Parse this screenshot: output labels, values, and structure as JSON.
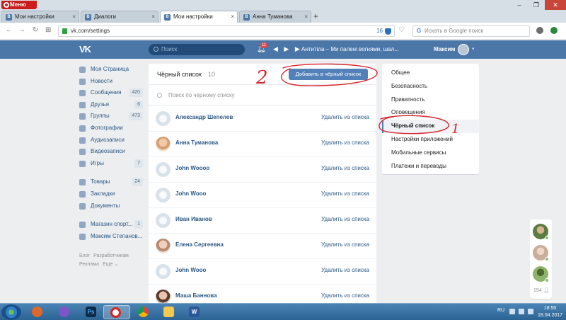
{
  "browser": {
    "menu_label": "Меню",
    "tabs": [
      {
        "label": "Мои настройки"
      },
      {
        "label": "Диалоги"
      },
      {
        "label": "Мои настройки"
      },
      {
        "label": "Анна Туманова"
      }
    ],
    "new_tab": "+",
    "url": "vk.com/settings",
    "url_badge": "16",
    "search_placeholder": "Искать в Google поиск",
    "search_engine_letter": "G"
  },
  "vk_header": {
    "logo": "VK",
    "search_placeholder": "Поиск",
    "notifications_count": "11",
    "track": "Антитіла – Ми палені вогнями, шал...",
    "user_name": "Максим"
  },
  "left_menu": {
    "items": [
      {
        "label": "Моя Страница",
        "count": ""
      },
      {
        "label": "Новости",
        "count": ""
      },
      {
        "label": "Сообщения",
        "count": "420"
      },
      {
        "label": "Друзья",
        "count": "6"
      },
      {
        "label": "Группы",
        "count": "473"
      },
      {
        "label": "Фотографии",
        "count": ""
      },
      {
        "label": "Аудиозаписи",
        "count": ""
      },
      {
        "label": "Видеозаписи",
        "count": ""
      },
      {
        "label": "Игры",
        "count": "7"
      }
    ],
    "items2": [
      {
        "label": "Товары",
        "count": "24"
      },
      {
        "label": "Закладки",
        "count": ""
      },
      {
        "label": "Документы",
        "count": ""
      }
    ],
    "items3": [
      {
        "label": "Магазин спорт...",
        "count": "1"
      },
      {
        "label": "Максим Степанов...",
        "count": ""
      }
    ],
    "footer": [
      "Блог",
      "Разработчикам",
      "Реклама",
      "Ещё ⌄"
    ]
  },
  "blacklist": {
    "title": "Чёрный список",
    "count": "10",
    "add_button": "Добавить в чёрный список",
    "search_placeholder": "Поиск по чёрному списку",
    "remove_label": "Удалить из списка",
    "rows": [
      {
        "name": "Александр Шепелев"
      },
      {
        "name": "Анна Туманова"
      },
      {
        "name": "John Woooo"
      },
      {
        "name": "John Wooo"
      },
      {
        "name": "Иван Иванов"
      },
      {
        "name": "Елена Сергеевна"
      },
      {
        "name": "John Wooo"
      },
      {
        "name": "Маша Баннова"
      }
    ]
  },
  "settings_menu": {
    "items": [
      {
        "label": "Общее"
      },
      {
        "label": "Безопасность"
      },
      {
        "label": "Приватность"
      },
      {
        "label": "Оповещения"
      },
      {
        "label": "Чёрный список"
      },
      {
        "label": "Настройки приложений"
      },
      {
        "label": "Мобильные сервисы"
      },
      {
        "label": "Платежи и переводы"
      }
    ],
    "active_index": 4
  },
  "annotations": {
    "mark_1": "1",
    "mark_2": "2",
    "color": "#d8262e"
  },
  "chat_rail": {
    "online_count": "154"
  },
  "taskbar": {
    "language": "RU",
    "time": "18:50",
    "date": "18.04.2017",
    "apps": [
      {
        "icon": "ps-icon",
        "label": "Ps"
      },
      {
        "icon": "word-icon",
        "label": "W"
      }
    ]
  },
  "colors": {
    "vk_blue": "#4a76a8",
    "button_blue": "#5181b8",
    "link_blue": "#2a5885",
    "background": "#edeef0"
  }
}
